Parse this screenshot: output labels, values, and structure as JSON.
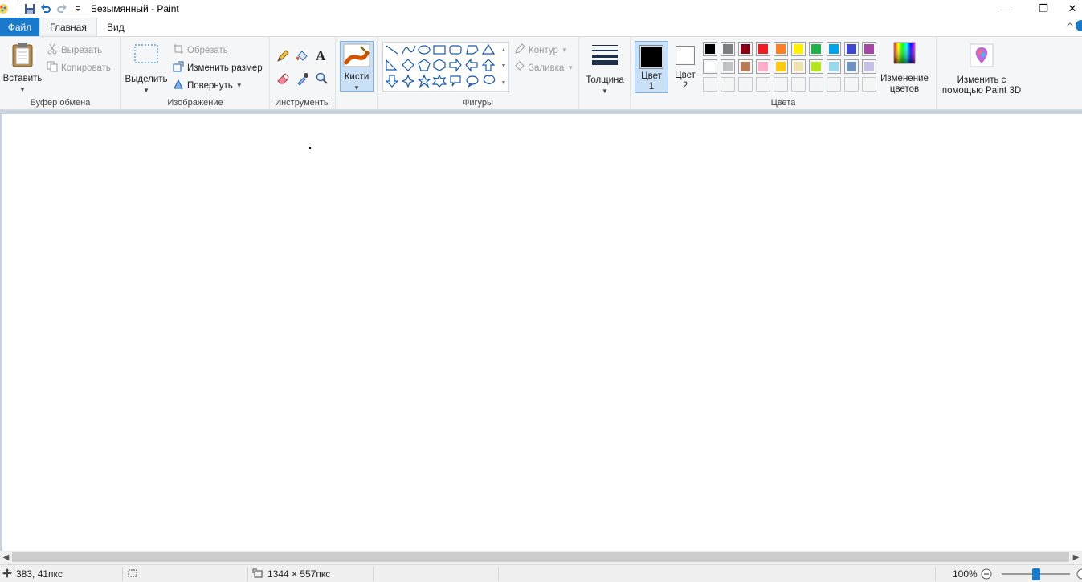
{
  "window": {
    "title": "Безымянный - Paint",
    "minimize": "—",
    "maximize": "❐",
    "close": "✕"
  },
  "tabs": {
    "file": "Файл",
    "home": "Главная",
    "view": "Вид"
  },
  "clipboard": {
    "paste": "Вставить",
    "cut": "Вырезать",
    "copy": "Копировать",
    "label": "Буфер обмена"
  },
  "image": {
    "select": "Выделить",
    "crop": "Обрезать",
    "resize": "Изменить размер",
    "rotate": "Повернуть",
    "label": "Изображение"
  },
  "tools": {
    "label": "Инструменты",
    "text_glyph": "A"
  },
  "brushes": {
    "label": "Кисти"
  },
  "shapes": {
    "outline": "Контур",
    "fill": "Заливка",
    "label": "Фигуры"
  },
  "size": {
    "label": "Толщина"
  },
  "colors": {
    "color1_line1": "Цвет",
    "color1_line2": "1",
    "color2_line1": "Цвет",
    "color2_line2": "2",
    "edit_line1": "Изменение",
    "edit_line2": "цветов",
    "label": "Цвета",
    "color1_value": "#000000",
    "color2_value": "#ffffff",
    "palette_row1": [
      "#000000",
      "#7f7f7f",
      "#880015",
      "#ed1c24",
      "#ff7f27",
      "#fff200",
      "#22b14c",
      "#00a2e8",
      "#3f48cc",
      "#a349a4"
    ],
    "palette_row2": [
      "#ffffff",
      "#c3c3c3",
      "#b97a57",
      "#ffaec9",
      "#ffc90e",
      "#efe4b0",
      "#b5e61d",
      "#99d9ea",
      "#7092be",
      "#c8bfe7"
    ],
    "palette_row3": [
      "#f5f5f5",
      "#f5f5f5",
      "#f5f5f5",
      "#f5f5f5",
      "#f5f5f5",
      "#f5f5f5",
      "#f5f5f5",
      "#f5f5f5",
      "#f5f5f5",
      "#f5f5f5"
    ]
  },
  "paint3d": {
    "line1": "Изменить с",
    "line2": "помощью Paint 3D"
  },
  "status": {
    "cursor_pos": "383, 41пкс",
    "canvas_size": "1344 × 557пкс",
    "zoom": "100%"
  }
}
